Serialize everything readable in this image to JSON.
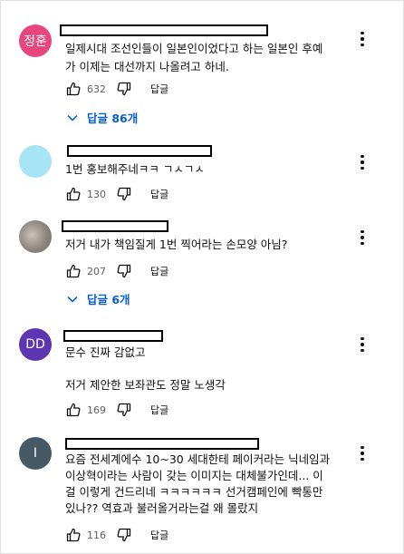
{
  "comments": [
    {
      "avatar_text": "정훈",
      "avatar_color": "#e8467c",
      "text_lines": [
        "일제시대 조선인들이 일본인이었다고 하는 일본인 후예",
        "가 이제는 대선까지 나올려고 하네."
      ],
      "likes": "632",
      "reply_label": "답글",
      "replies_label": "답글 86개"
    },
    {
      "avatar_text": "",
      "avatar_color": "#a6e4f6",
      "text_lines": [
        "1번 홍보해주네ㅋㅋ ㄱㅅㄱㅅ"
      ],
      "likes": "130",
      "reply_label": "답글"
    },
    {
      "avatar_text": "",
      "avatar_color": "#9a9187",
      "text_lines": [
        "저거 내가 책임질게 1번 찍어라는 손모양 아님?"
      ],
      "likes": "207",
      "reply_label": "답글",
      "replies_label": "답글 6개"
    },
    {
      "avatar_text": "DD",
      "avatar_color": "#5e35b1",
      "text_lines": [
        "문수 진짜 감없고",
        "",
        "저거 제안한 보좌관도 정말 노생각"
      ],
      "likes": "169",
      "reply_label": "답글"
    },
    {
      "avatar_text": "I",
      "avatar_color": "#455a64",
      "text_lines": [
        "요즘 전세계에수 10~30 세대한테 페이커라는 닉네임과",
        "이상혁이라는 사람이 갖는 이미지는 대체불가인데... 이",
        "걸 이렇게 건드리네 ㅋㅋㅋㅋㅋㅋ 선거캠페인에 빡통만",
        "있나?? 역효과 불러올거라는걸 왜 몰랐지"
      ],
      "likes": "116",
      "reply_label": "답글"
    }
  ],
  "colors": {
    "link": "#065fd4",
    "muted": "#606060"
  }
}
